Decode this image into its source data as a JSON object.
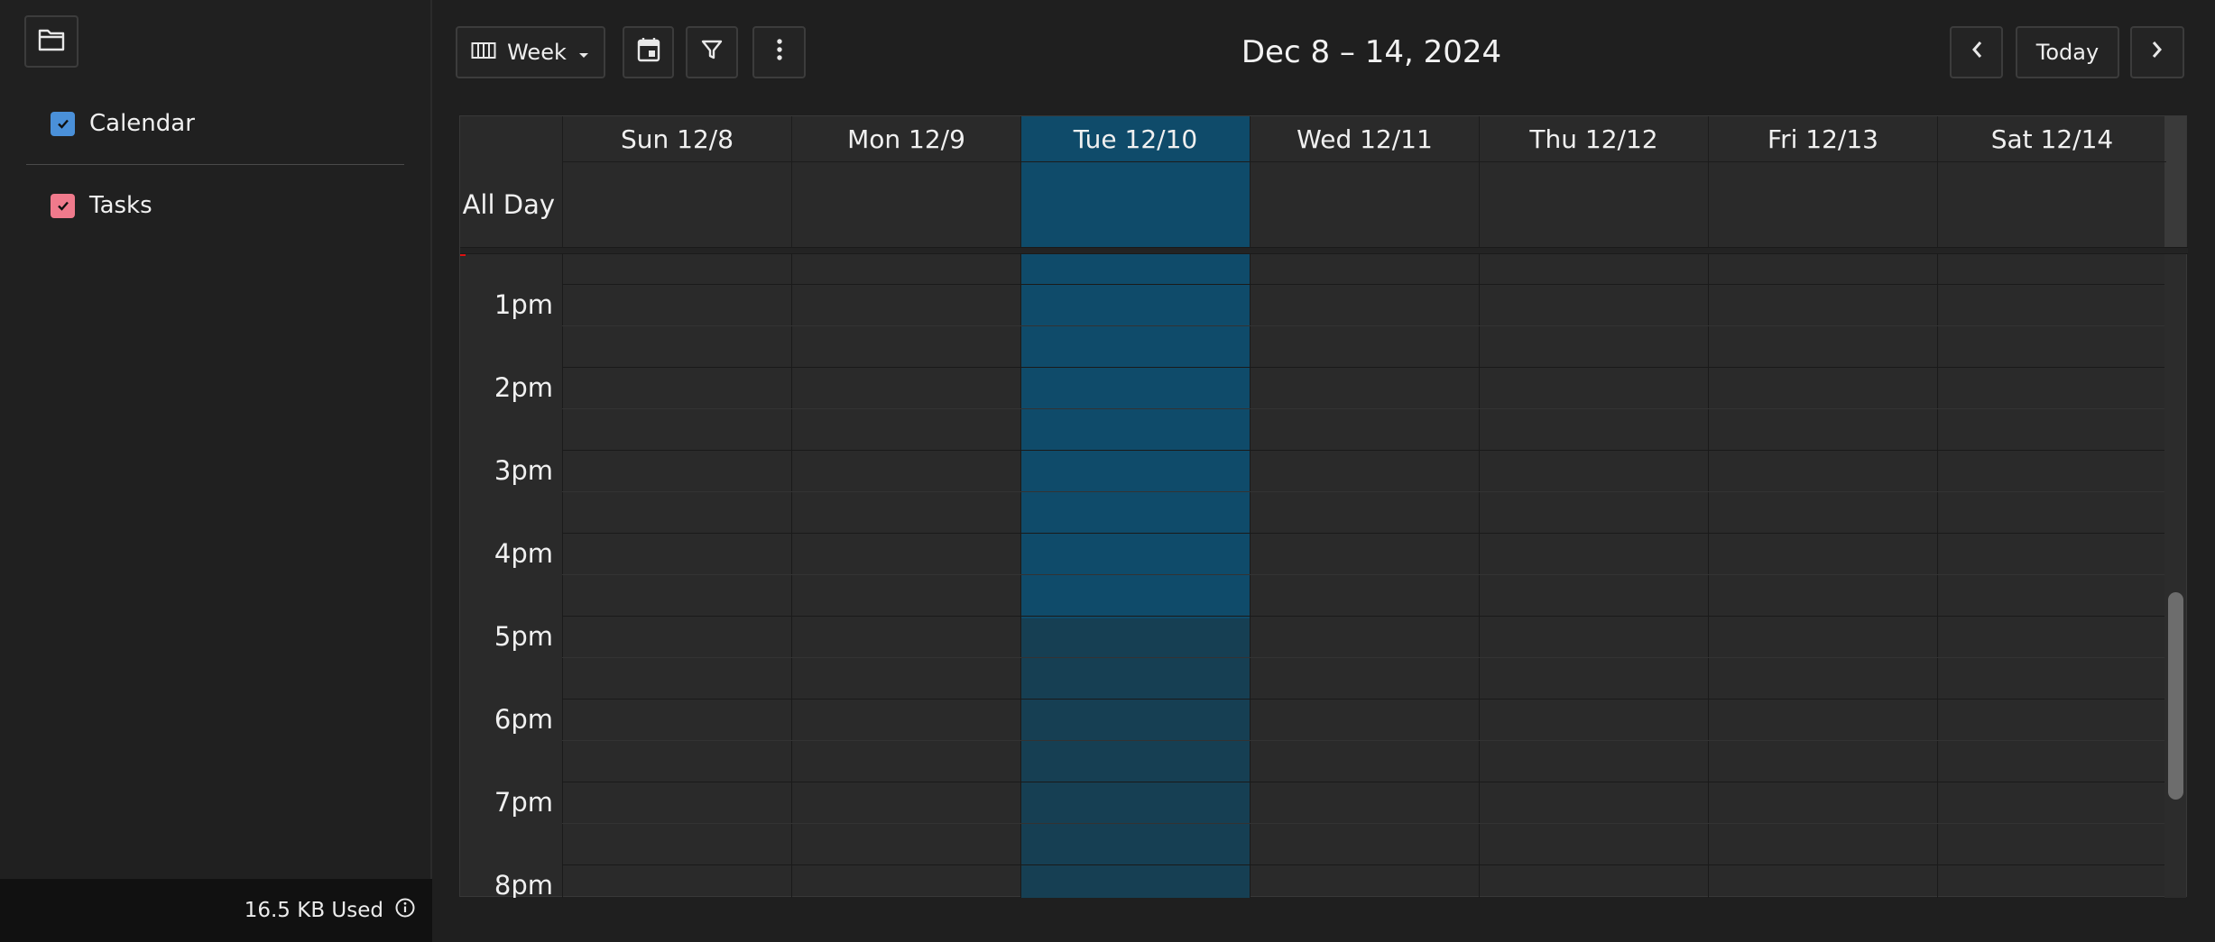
{
  "sidebar": {
    "calendars": [
      {
        "label": "Calendar",
        "color": "#4a90d9"
      },
      {
        "label": "Tasks",
        "color": "#f07a8c"
      }
    ],
    "storage_text": "16.5 KB Used"
  },
  "toolbar": {
    "view_label": "Week",
    "range_title": "Dec 8 – 14, 2024",
    "today_label": "Today"
  },
  "calendar": {
    "days": [
      "Sun 12/8",
      "Mon 12/9",
      "Tue 12/10",
      "Wed 12/11",
      "Thu 12/12",
      "Fri 12/13",
      "Sat 12/14"
    ],
    "today_index": 2,
    "all_day_label": "All Day",
    "hours": [
      "1pm",
      "2pm",
      "3pm",
      "4pm",
      "5pm",
      "6pm",
      "7pm",
      "8pm"
    ],
    "today_color": "#0f4b6a",
    "today_color_after": "#163f53"
  }
}
